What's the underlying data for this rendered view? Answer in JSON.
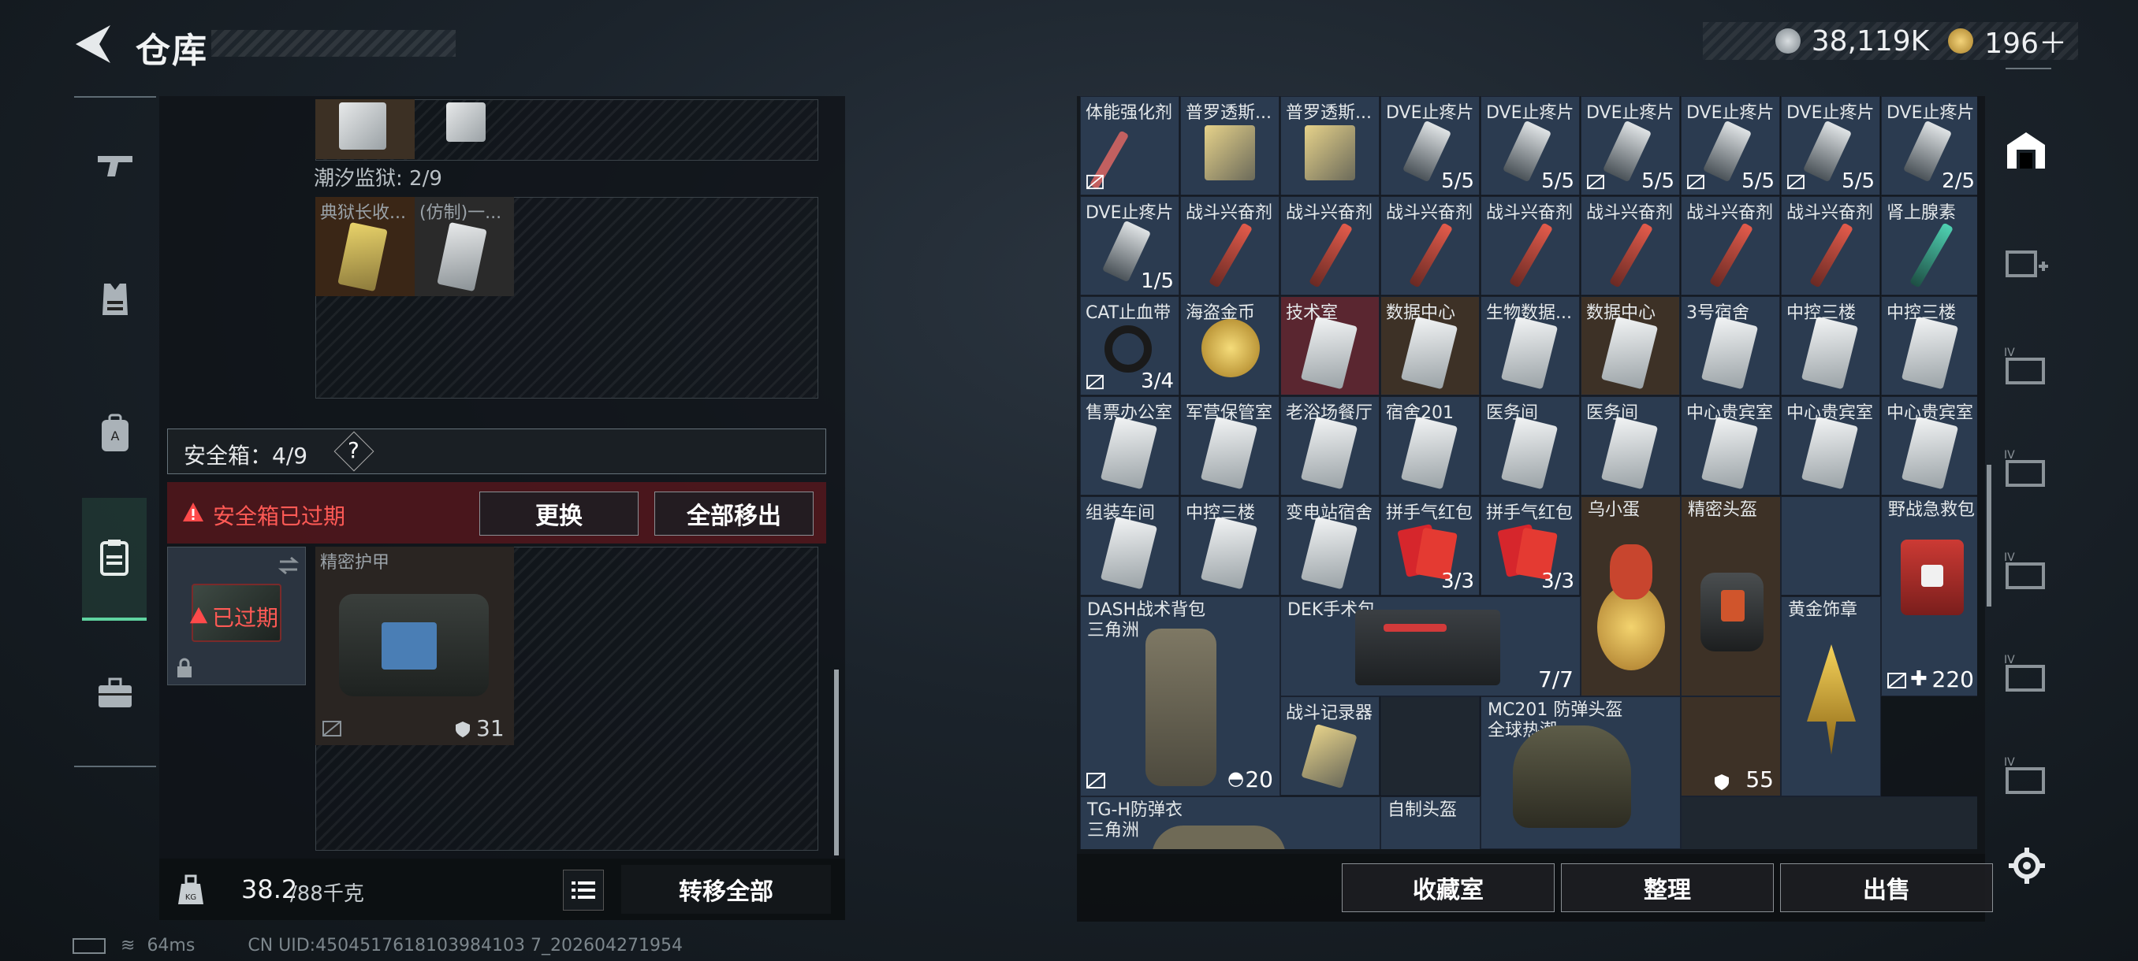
{
  "header": {
    "title": "仓库",
    "currency_a": "38,119K",
    "currency_b": "196＋"
  },
  "nav": {
    "items": [
      "weapon",
      "armor",
      "backpack",
      "safebox",
      "toolbox"
    ],
    "active": 3
  },
  "left": {
    "prison_label": "潮汐监狱: 2/9",
    "prison_items": [
      "典狱长收...",
      "(仿制)一..."
    ],
    "safebox_title": "安全箱：4/9",
    "help": "?",
    "expired_msg": "安全箱已过期",
    "btn_replace": "更换",
    "btn_move_all_out": "全部移出",
    "expired_badge": "已过期",
    "armor_name": "精密护甲",
    "armor_value": "31",
    "weight_current": "38.2",
    "weight_max": "/88千克",
    "transfer_all": "转移全部"
  },
  "status": {
    "ping": "64ms",
    "uid": "CN UID:4504517618103984103 7_202604271954"
  },
  "inventory": {
    "row1": [
      {
        "name": "体能强化剂",
        "count": ""
      },
      {
        "name": "普罗透斯...",
        "count": ""
      },
      {
        "name": "普罗透斯...",
        "count": ""
      },
      {
        "name": "DVE止疼片",
        "count": "5/5"
      },
      {
        "name": "DVE止疼片",
        "count": "5/5"
      },
      {
        "name": "DVE止疼片",
        "count": "5/5"
      },
      {
        "name": "DVE止疼片",
        "count": "5/5"
      },
      {
        "name": "DVE止疼片",
        "count": "5/5"
      },
      {
        "name": "DVE止疼片",
        "count": "2/5"
      }
    ],
    "row2": [
      {
        "name": "DVE止疼片",
        "count": "1/5"
      },
      {
        "name": "战斗兴奋剂",
        "count": ""
      },
      {
        "name": "战斗兴奋剂",
        "count": ""
      },
      {
        "name": "战斗兴奋剂",
        "count": ""
      },
      {
        "name": "战斗兴奋剂",
        "count": ""
      },
      {
        "name": "战斗兴奋剂",
        "count": ""
      },
      {
        "name": "战斗兴奋剂",
        "count": ""
      },
      {
        "name": "战斗兴奋剂",
        "count": ""
      },
      {
        "name": "肾上腺素",
        "count": ""
      }
    ],
    "row3": [
      {
        "name": "CAT止血带",
        "count": "3/4"
      },
      {
        "name": "海盗金币",
        "count": ""
      },
      {
        "name": "技术室",
        "count": ""
      },
      {
        "name": "数据中心",
        "count": ""
      },
      {
        "name": "生物数据...",
        "count": ""
      },
      {
        "name": "数据中心",
        "count": ""
      },
      {
        "name": "3号宿舍",
        "count": ""
      },
      {
        "name": "中控三楼",
        "count": ""
      },
      {
        "name": "中控三楼",
        "count": ""
      }
    ],
    "row4": [
      {
        "name": "售票办公室",
        "count": ""
      },
      {
        "name": "军营保管室",
        "count": ""
      },
      {
        "name": "老浴场餐厅",
        "count": ""
      },
      {
        "name": "宿舍201",
        "count": ""
      },
      {
        "name": "医务间",
        "count": ""
      },
      {
        "name": "医务间",
        "count": ""
      },
      {
        "name": "中心贵宾室",
        "count": ""
      },
      {
        "name": "中心贵宾室",
        "count": ""
      },
      {
        "name": "中心贵宾室",
        "count": ""
      }
    ],
    "row5": [
      {
        "name": "组装车间",
        "count": ""
      },
      {
        "name": "中控三楼",
        "count": ""
      },
      {
        "name": "变电站宿舍",
        "count": ""
      },
      {
        "name": "拼手气红包",
        "count": "3/3"
      },
      {
        "name": "拼手气红包",
        "count": "3/3"
      },
      {
        "name": "乌小蛋",
        "count": ""
      },
      {
        "name": "精密头盔",
        "count": ""
      },
      {
        "name": "",
        "count": ""
      }
    ],
    "firstaid": {
      "name": "野战急救包",
      "count": "220"
    },
    "dash": {
      "name": "DASH战术背包",
      "sub": "三角洲",
      "count": "20"
    },
    "dek": {
      "name": "DEK手术包",
      "count": "7/7"
    },
    "medal": {
      "name": "黄金饰章"
    },
    "recorder": {
      "name": "战斗记录器"
    },
    "mc201": {
      "name": "MC201 防弹头盔",
      "sub": "全球热潮"
    },
    "helmet_durability": "55",
    "tgh": {
      "name": "TG-H防弹衣",
      "sub": "三角洲"
    },
    "homemade": {
      "name": "自制头盔"
    }
  },
  "actions": {
    "collection": "收藏室",
    "sort": "整理",
    "sell": "出售"
  }
}
